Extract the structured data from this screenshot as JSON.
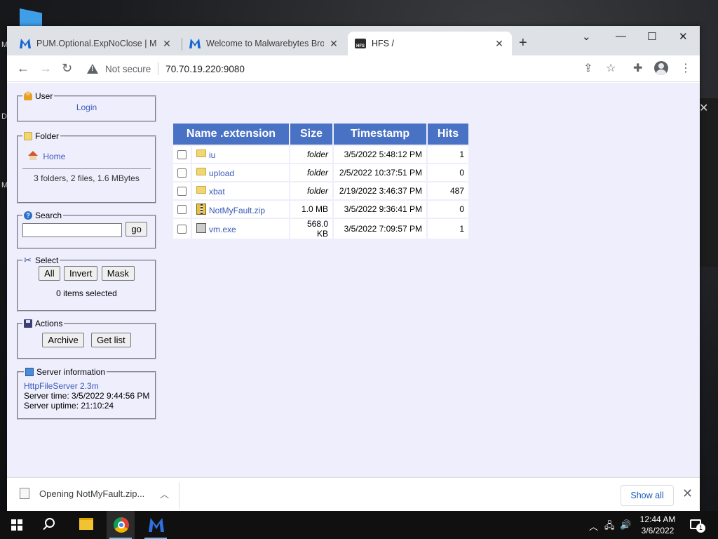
{
  "tabs": [
    {
      "title": "PUM.Optional.ExpNoClose | Mal",
      "icon": "malwarebytes-icon"
    },
    {
      "title": "Welcome to Malwarebytes Brow",
      "icon": "malwarebytes-icon"
    },
    {
      "title": "HFS /",
      "icon": "hfs-icon",
      "active": true
    }
  ],
  "toolbar": {
    "security_label": "Not secure",
    "url": "70.70.19.220:9080"
  },
  "panels": {
    "user": {
      "legend": "User",
      "login": "Login"
    },
    "folder": {
      "legend": "Folder",
      "home": "Home",
      "summary": "3 folders, 2 files, 1.6 MBytes"
    },
    "search": {
      "legend": "Search",
      "go": "go",
      "value": ""
    },
    "select": {
      "legend": "Select",
      "all": "All",
      "invert": "Invert",
      "mask": "Mask",
      "status": "0 items selected"
    },
    "actions": {
      "legend": "Actions",
      "archive": "Archive",
      "get_list": "Get list"
    },
    "server": {
      "legend": "Server information",
      "software": "HttpFileServer 2.3m",
      "time": "Server time: 3/5/2022 9:44:56 PM",
      "uptime": "Server uptime: 21:10:24"
    }
  },
  "table": {
    "headers": [
      "Name .extension",
      "Size",
      "Timestamp",
      "Hits"
    ],
    "rows": [
      {
        "name": "iu",
        "type": "folder",
        "size": "folder",
        "timestamp": "3/5/2022 5:48:12 PM",
        "hits": "1"
      },
      {
        "name": "upload",
        "type": "folder",
        "size": "folder",
        "timestamp": "2/5/2022 10:37:51 PM",
        "hits": "0"
      },
      {
        "name": "xbat",
        "type": "folder",
        "size": "folder",
        "timestamp": "2/19/2022 3:46:37 PM",
        "hits": "487"
      },
      {
        "name": "NotMyFault.zip",
        "type": "zip",
        "size": "1.0 MB",
        "timestamp": "3/5/2022 9:36:41 PM",
        "hits": "0"
      },
      {
        "name": "vm.exe",
        "type": "exe",
        "size": "568.0 KB",
        "timestamp": "3/5/2022 7:09:57 PM",
        "hits": "1"
      }
    ]
  },
  "downloads": {
    "item": "Opening NotMyFault.zip...",
    "show_all": "Show all"
  },
  "taskbar": {
    "time": "12:44 AM",
    "date": "3/6/2022",
    "notification_count": "1"
  },
  "desktop": {
    "edge_letters": [
      "D",
      "M",
      "M"
    ]
  },
  "colors": {
    "header_blue": "#4a72c4",
    "page_bg": "#eeeefd",
    "link": "#3a5ab7"
  }
}
